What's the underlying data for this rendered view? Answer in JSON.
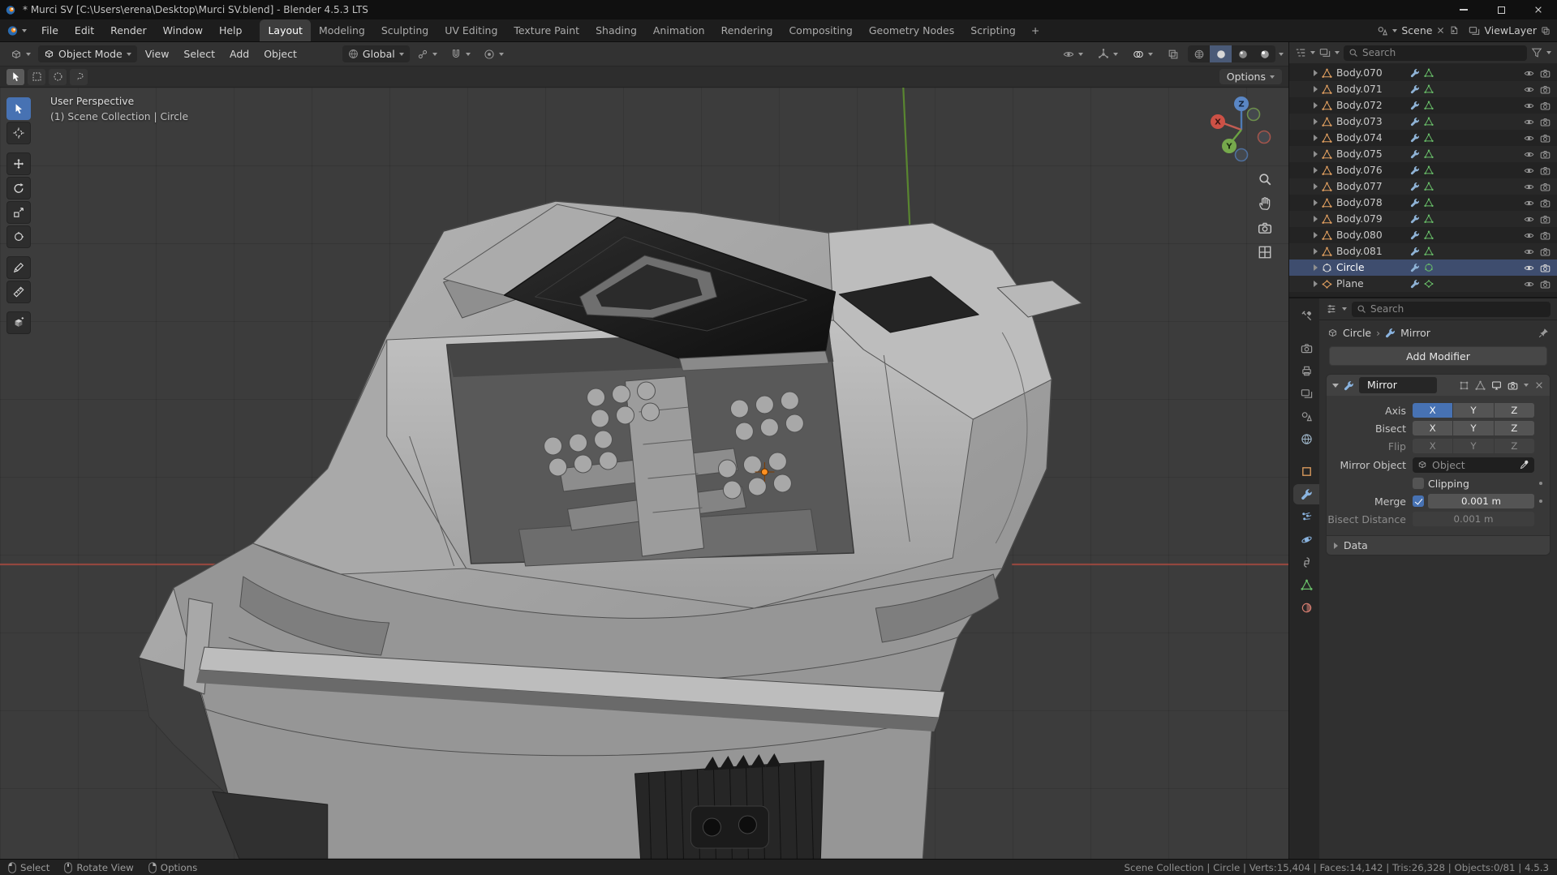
{
  "colors": {
    "accent": "#4772b3",
    "axis_x_red": "#a84a40",
    "axis_y_green": "#5d8f2f",
    "mesh_icon_orange": "#e2a060",
    "mesh_data_green": "#69bf69",
    "modifier_blue": "#8ab4e0"
  },
  "titlebar": {
    "title": "* Murci SV [C:\\Users\\erena\\Desktop\\Murci SV.blend] - Blender 4.5.3 LTS"
  },
  "topbar": {
    "menus": [
      {
        "label": "File"
      },
      {
        "label": "Edit"
      },
      {
        "label": "Render"
      },
      {
        "label": "Window"
      },
      {
        "label": "Help"
      }
    ],
    "workspaces": [
      {
        "label": "Layout",
        "active": true
      },
      {
        "label": "Modeling"
      },
      {
        "label": "Sculpting"
      },
      {
        "label": "UV Editing"
      },
      {
        "label": "Texture Paint"
      },
      {
        "label": "Shading"
      },
      {
        "label": "Animation"
      },
      {
        "label": "Rendering"
      },
      {
        "label": "Compositing"
      },
      {
        "label": "Geometry Nodes"
      },
      {
        "label": "Scripting"
      }
    ],
    "add_workspace": "+",
    "scene": {
      "label": "Scene"
    },
    "viewlayer": {
      "label": "ViewLayer"
    }
  },
  "viewport_header": {
    "mode": "Object Mode",
    "menus": [
      {
        "label": "View"
      },
      {
        "label": "Select"
      },
      {
        "label": "Add"
      },
      {
        "label": "Object"
      }
    ],
    "orientation": "Global"
  },
  "tool_settings": {
    "options": "Options"
  },
  "viewport": {
    "view_label": "User Perspective",
    "context_label": "(1) Scene Collection | Circle",
    "gizmo": {
      "x": "X",
      "y": "Y",
      "z": "Z"
    }
  },
  "outliner": {
    "search_placeholder": "Search",
    "items": [
      {
        "name": "Body.070"
      },
      {
        "name": "Body.071"
      },
      {
        "name": "Body.072"
      },
      {
        "name": "Body.073"
      },
      {
        "name": "Body.074"
      },
      {
        "name": "Body.075"
      },
      {
        "name": "Body.076"
      },
      {
        "name": "Body.077"
      },
      {
        "name": "Body.078"
      },
      {
        "name": "Body.079"
      },
      {
        "name": "Body.080"
      },
      {
        "name": "Body.081"
      },
      {
        "name": "Circle",
        "selected": true
      },
      {
        "name": "Plane"
      }
    ]
  },
  "properties": {
    "search_placeholder": "Search",
    "breadcrumb": {
      "object": "Circle",
      "separator": "›",
      "modifier": "Mirror"
    },
    "add_modifier": "Add Modifier",
    "modifier": {
      "name": "Mirror",
      "axis_label": "Axis",
      "bisect_label": "Bisect",
      "flip_label": "Flip",
      "axes": [
        "X",
        "Y",
        "Z"
      ],
      "active_axis": "X",
      "mirror_object_label": "Mirror Object",
      "mirror_object_placeholder": "Object",
      "clipping_label": "Clipping",
      "merge_label": "Merge",
      "merge_value": "0.001 m",
      "bisect_distance_label": "Bisect Distance",
      "bisect_distance_value": "0.001 m",
      "data_section": "Data"
    }
  },
  "statusbar": {
    "left": [
      {
        "label": "Select"
      },
      {
        "label": "Rotate View"
      },
      {
        "label": "Options"
      }
    ],
    "stats": "Scene Collection | Circle | Verts:15,404 | Faces:14,142 | Tris:26,328 | Objects:0/81 | 4.5.3"
  }
}
